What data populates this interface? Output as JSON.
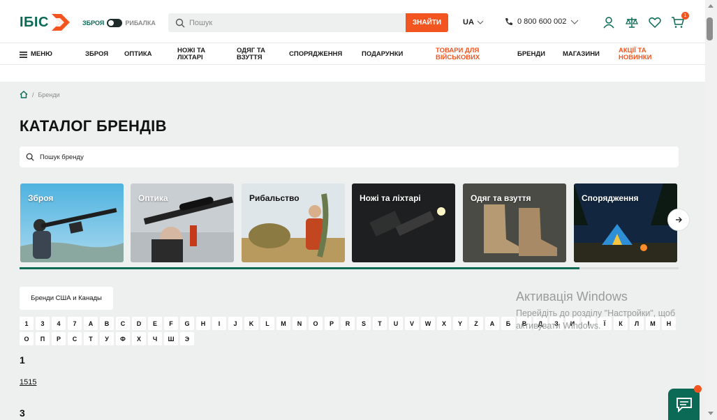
{
  "colors": {
    "brand": "#0b6a55",
    "accent": "#f2551f",
    "background": "#eef0f0"
  },
  "header": {
    "logo_text": "ІБІС",
    "mode_on": "ЗБРОЯ",
    "mode_off": "РИБАЛКА",
    "search_placeholder": "Пошук",
    "search_button": "ЗНАЙТИ",
    "language": "UA",
    "phone": "0 800 600 002",
    "cart_count": "1"
  },
  "nav": {
    "menu": "МЕНЮ",
    "items": [
      "ЗБРОЯ",
      "ОПТИКА",
      "НОЖІ ТА ЛІХТАРІ",
      "ОДЯГ ТА ВЗУТТЯ",
      "СПОРЯДЖЕННЯ",
      "ПОДАРУНКИ",
      "ТОВАРИ ДЛЯ ВІЙСЬКОВИХ",
      "БРЕНДИ",
      "МАГАЗИНИ",
      "АКЦІЇ ТА НОВИНКИ"
    ]
  },
  "breadcrumb": {
    "current": "Бренди"
  },
  "page": {
    "title": "КАТАЛОГ БРЕНДІВ",
    "brand_search_placeholder": "Пошук бренду"
  },
  "categories": [
    {
      "label": "Зброя",
      "icon": "rifle-shooter-image"
    },
    {
      "label": "Оптика",
      "icon": "scope-rifle-image"
    },
    {
      "label": "Рибальство",
      "icon": "fisherman-image"
    },
    {
      "label": "Ножі та ліхтарі",
      "icon": "knife-flashlight-image"
    },
    {
      "label": "Одяг та взуття",
      "icon": "boots-image"
    },
    {
      "label": "Спорядження",
      "icon": "tent-camp-image"
    }
  ],
  "slider_progress": 0.85,
  "region_tab": "Бренди США и Канады",
  "alphabet": [
    "1",
    "3",
    "4",
    "7",
    "A",
    "B",
    "C",
    "D",
    "E",
    "F",
    "G",
    "H",
    "I",
    "J",
    "K",
    "L",
    "M",
    "N",
    "O",
    "P",
    "R",
    "S",
    "T",
    "U",
    "V",
    "W",
    "X",
    "Y",
    "Z",
    "А",
    "Б",
    "В",
    "Д",
    "З",
    "И",
    "І",
    "Ї",
    "К",
    "Л",
    "М",
    "Н",
    "О",
    "П",
    "Р",
    "С",
    "Т",
    "У",
    "Ф",
    "Х",
    "Ч",
    "Ш",
    "Э"
  ],
  "groups": [
    {
      "letter": "1",
      "brands": [
        "1515"
      ]
    },
    {
      "letter": "3",
      "brands": []
    }
  ],
  "watermark": {
    "title": "Активація Windows",
    "line1": "Перейдіть до розділу \"Настройки\", щоб",
    "line2": "активувати Windows."
  }
}
